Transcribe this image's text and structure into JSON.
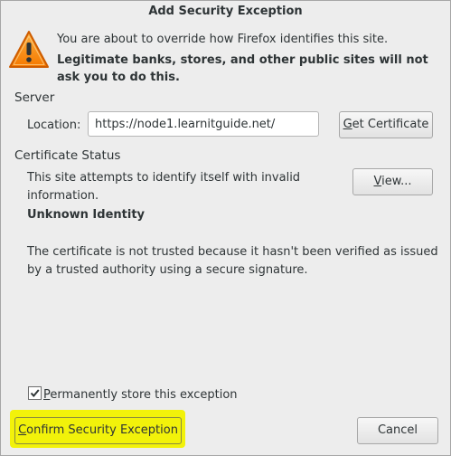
{
  "dialog": {
    "title": "Add Security Exception"
  },
  "warning": {
    "icon": "warning-triangle-icon",
    "line1": "You are about to override how Firefox identifies this site.",
    "line2": "Legitimate banks, stores, and other public sites will not ask you to do this."
  },
  "server": {
    "heading": "Server",
    "location_label": "Location:",
    "location_value": "https://node1.learnitguide.net/",
    "get_certificate_label": "Get Certificate"
  },
  "certificate_status": {
    "heading": "Certificate Status",
    "text1": "This site attempts to identify itself with invalid information.",
    "view_label": "View...",
    "identity_heading": "Unknown Identity",
    "text2": "The certificate is not trusted because it hasn't been verified as issued by a trusted authority using a secure signature."
  },
  "footer": {
    "permanent_store_label": "Permanently store this exception",
    "permanent_store_checked": true,
    "confirm_label": "Confirm Security Exception",
    "cancel_label": "Cancel"
  },
  "colors": {
    "highlight": "#f2f20a",
    "warning_fill": "#f57900",
    "background": "#ededed"
  }
}
